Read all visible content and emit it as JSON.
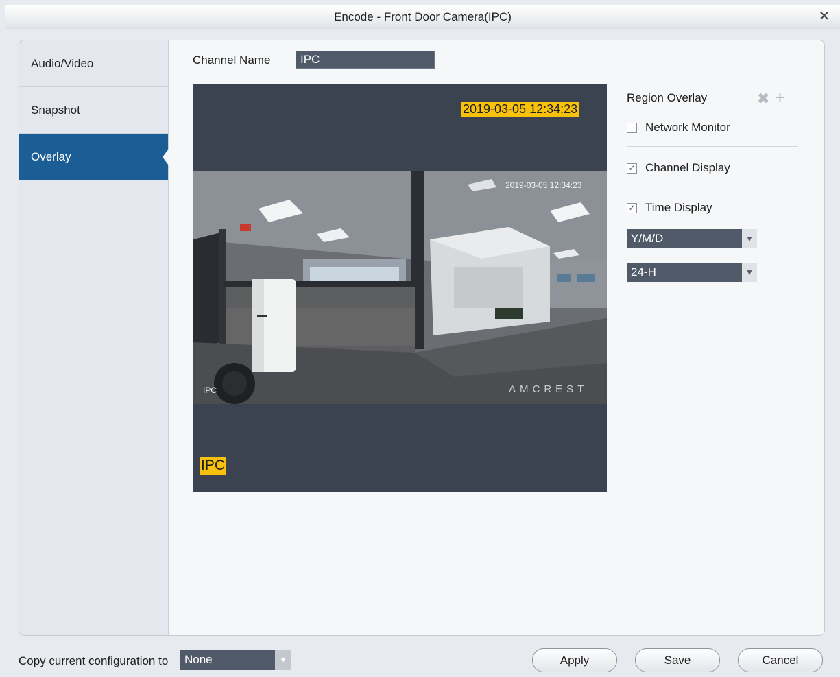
{
  "window": {
    "title": "Encode  - Front Door Camera(IPC)",
    "close_icon": "close-icon"
  },
  "sidebar": {
    "items": [
      {
        "label": "Audio/Video",
        "active": false
      },
      {
        "label": "Snapshot",
        "active": false
      },
      {
        "label": "Overlay",
        "active": true
      }
    ]
  },
  "channel": {
    "label": "Channel Name",
    "value": "IPC"
  },
  "preview": {
    "time_overlay": "2019-03-05 12:34:23",
    "channel_overlay": "IPC",
    "camera_timestamp": "2019-03-05 12:34:23",
    "camera_channel": "IPC",
    "camera_watermark": "AMCREST"
  },
  "overlay_settings": {
    "region_label": "Region Overlay",
    "network_monitor": {
      "label": "Network Monitor",
      "checked": false
    },
    "channel_display": {
      "label": "Channel Display",
      "checked": true
    },
    "time_display": {
      "label": "Time Display",
      "checked": true
    },
    "date_format": "Y/M/D",
    "time_format": "24-H"
  },
  "footer": {
    "copy_label": "Copy current configuration to",
    "copy_value": "None",
    "apply_label": "Apply",
    "save_label": "Save",
    "cancel_label": "Cancel"
  },
  "colors": {
    "accent": "#1b5e96",
    "overlay_highlight": "#f8c10c",
    "preview_bg": "#3b4250",
    "field_bg": "#505a68"
  }
}
